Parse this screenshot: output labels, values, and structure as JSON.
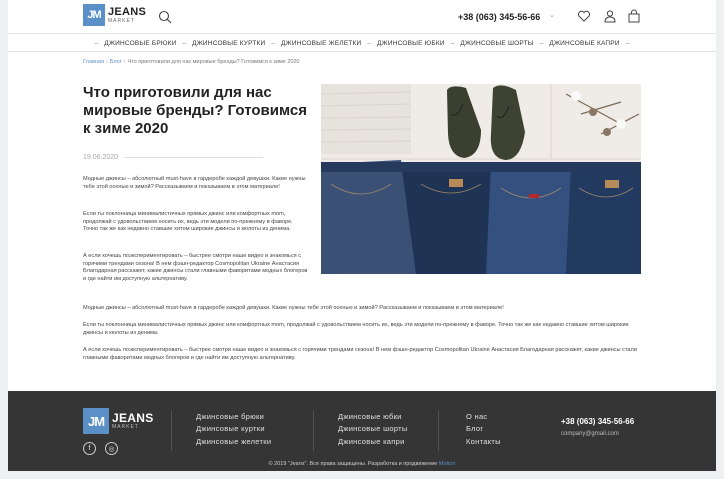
{
  "header": {
    "logo_mark": "JM",
    "logo_name": "JEANS",
    "logo_sub": "MARKET",
    "phone": "+38 (063) 345-56-66",
    "phone_caret": "⌄"
  },
  "nav": {
    "items": [
      "ДЖИНСОВЫЕ БРЮКИ",
      "ДЖИНСОВЫЕ КУРТКИ",
      "ДЖИНСОВЫЕ ЖЕЛЕТКИ",
      "ДЖИНСОВЫЕ ЮБКИ",
      "ДЖИНСОВЫЕ ШОРТЫ",
      "ДЖИНСОВЫЕ КАПРИ"
    ]
  },
  "breadcrumb": {
    "home": "Главная",
    "blog": "Блог",
    "current": "Что приготовили для нас мировые бренды? Готовимся к зиме 2020"
  },
  "article": {
    "title": "Что приготовили для нас мировые бренды? Готовимся к зиме 2020",
    "date": "19.06.2020",
    "p1": "Модные джинсы – абсолютный must-have в гардеробе каждой девушки. Какие нужны тебе этой осенью и зимой? Рассказываем и показываем в этом материале!",
    "p2": "Если ты поклонница минималистичных прямых джинс или комфортных mom, продолжай с удовольствием носить их, ведь эти модели по-прежнему в фаворе. Точно так же как недавно ставшие хитом широкие джинсы и кюлоты из денима.",
    "p3": "А если хочешь поэкспериментировать – быстрее смотри наше видео и знакомься с горячими трендами сезона! В нем фэшн-редактор Cosmopolitan Ukraine Анастасия Благодарная расскажет, какие джинсы стали главными фаворитами модных блогеров и где найти им доступную альтернативу.",
    "p4": "Модные джинсы – абсолютный must-have в гардеробе каждой девушки. Какие нужны тебе этой осенью и зимой? Рассказываем и показываем в этом материале!",
    "p5": "Если ты поклонница минималистичных прямых джинс или комфортных mom, продолжай с удовольствием носить их, ведь эти модели по-прежнему в фаворе. Точно так же как недавно ставшие хитом широкие джинсы и кюлоты из денима.",
    "p6": "А если хочешь поэкспериментировать – быстрее смотри наше видео и знакомься с горячими трендами сезона! В нем фэшн-редактор Cosmopolitan Ukraine Анастасия Благодарная расскажет, какие джинсы стали главными фаворитами модных блогеров и где найти им доступную альтернативу."
  },
  "footer": {
    "logo_mark": "JM",
    "logo_name": "JEANS",
    "logo_sub": "MARKET",
    "social_facebook": "f",
    "social_instagram": "◎",
    "col1": [
      "Джинсовые брюки",
      "Джинсовые куртки",
      "Джинсовые желетки"
    ],
    "col2": [
      "Джинсовые юбки",
      "Джинсовые шорты",
      "Джинсовые капри"
    ],
    "col3": [
      "О нас",
      "Блог",
      "Контакты"
    ],
    "phone": "+38 (063) 345-56-66",
    "email": "company@gmail.com",
    "copyright": "© 2019 \"Jeans\". Все права защищены. Разработка и продвижение",
    "copyright_brand": "Motion"
  },
  "colors": {
    "accent": "#5b8fc7",
    "footer_bg": "#353535",
    "page_bg": "#eef0f2"
  },
  "icons": [
    "search-icon",
    "heart-icon",
    "user-icon",
    "cart-icon"
  ]
}
